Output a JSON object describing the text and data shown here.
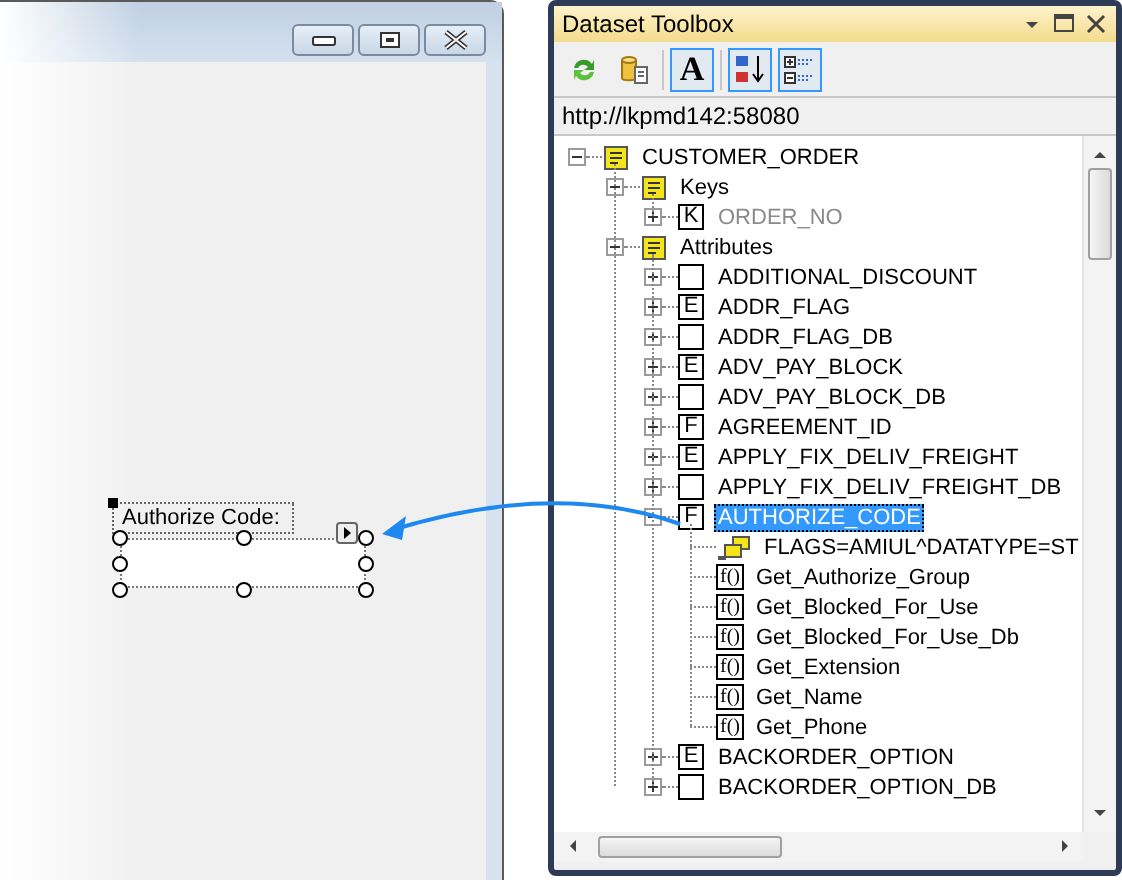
{
  "designer_window": {
    "form": {
      "label": "Authorize Code:",
      "field": {
        "selected": true
      }
    }
  },
  "toolbox": {
    "title": "Dataset Toolbox",
    "toolbar": [
      {
        "kind": "refresh",
        "checked": false
      },
      {
        "kind": "datasource",
        "checked": false
      },
      {
        "kind": "font",
        "label": "A",
        "checked": true
      },
      {
        "kind": "sort",
        "checked": true
      },
      {
        "kind": "expand",
        "checked": true
      }
    ],
    "url": "http://lkpmd142:58080",
    "tree": [
      {
        "label": "CUSTOMER_ORDER",
        "kind": "entity",
        "expanded": true,
        "selected": false,
        "children": [
          {
            "label": "Keys",
            "kind": "group",
            "expanded": true,
            "selected": false,
            "children": [
              {
                "label": "ORDER_NO",
                "kind": "attribute",
                "badge": "K",
                "expanded": false,
                "selected": false,
                "disabled": true
              }
            ]
          },
          {
            "label": "Attributes",
            "kind": "group",
            "expanded": true,
            "selected": false,
            "children": [
              {
                "label": "ADDITIONAL_DISCOUNT",
                "kind": "attribute",
                "expanded": false,
                "selected": false,
                "disabled": false
              },
              {
                "label": "ADDR_FLAG",
                "kind": "attribute",
                "badge": "E",
                "expanded": false,
                "selected": false,
                "disabled": false
              },
              {
                "label": "ADDR_FLAG_DB",
                "kind": "attribute",
                "expanded": false,
                "selected": false,
                "disabled": false
              },
              {
                "label": "ADV_PAY_BLOCK",
                "kind": "attribute",
                "badge": "E",
                "expanded": false,
                "selected": false,
                "disabled": false
              },
              {
                "label": "ADV_PAY_BLOCK_DB",
                "kind": "attribute",
                "expanded": false,
                "selected": false,
                "disabled": false
              },
              {
                "label": "AGREEMENT_ID",
                "kind": "attribute",
                "badge": "F",
                "expanded": false,
                "selected": false,
                "disabled": false
              },
              {
                "label": "APPLY_FIX_DELIV_FREIGHT",
                "kind": "attribute",
                "badge": "E",
                "expanded": false,
                "selected": false,
                "disabled": false
              },
              {
                "label": "APPLY_FIX_DELIV_FREIGHT_DB",
                "kind": "attribute",
                "expanded": false,
                "selected": false,
                "disabled": false
              },
              {
                "label": "AUTHORIZE_CODE",
                "kind": "attribute",
                "badge": "F",
                "expanded": true,
                "selected": true,
                "disabled": false,
                "children": [
                  {
                    "label": "FLAGS=AMIUL^DATATYPE=ST",
                    "kind": "flags",
                    "selected": false
                  },
                  {
                    "label": "Get_Authorize_Group",
                    "kind": "method",
                    "badge": "f()",
                    "selected": false
                  },
                  {
                    "label": "Get_Blocked_For_Use",
                    "kind": "method",
                    "badge": "f()",
                    "selected": false
                  },
                  {
                    "label": "Get_Blocked_For_Use_Db",
                    "kind": "method",
                    "badge": "f()",
                    "selected": false
                  },
                  {
                    "label": "Get_Extension",
                    "kind": "method",
                    "badge": "f()",
                    "selected": false
                  },
                  {
                    "label": "Get_Name",
                    "kind": "method",
                    "badge": "f()",
                    "selected": false
                  },
                  {
                    "label": "Get_Phone",
                    "kind": "method",
                    "badge": "f()",
                    "selected": false
                  }
                ]
              },
              {
                "label": "BACKORDER_OPTION",
                "kind": "attribute",
                "badge": "E",
                "expanded": false,
                "selected": false,
                "disabled": false
              },
              {
                "label": "BACKORDER_OPTION_DB",
                "kind": "attribute",
                "expanded": false,
                "selected": false,
                "disabled": false
              }
            ]
          }
        ]
      }
    ]
  }
}
